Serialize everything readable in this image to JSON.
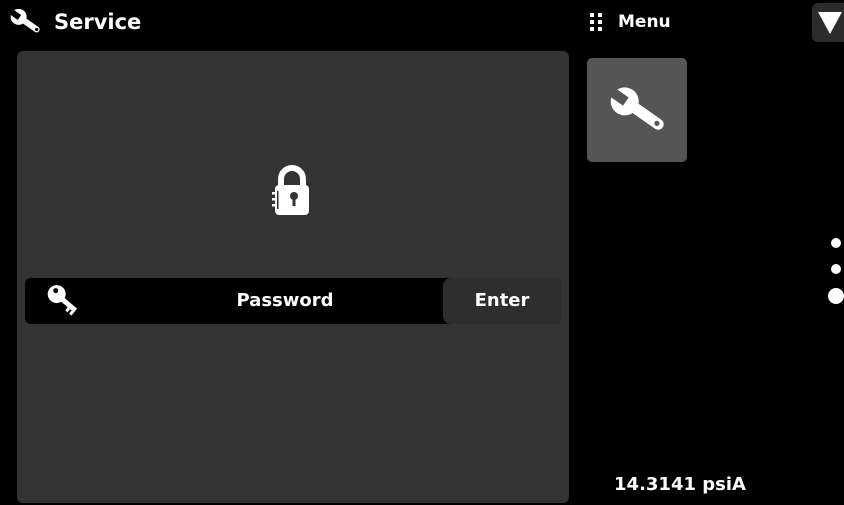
{
  "header": {
    "title": "Service",
    "title_icon": "wrench-icon",
    "menu_label": "Menu",
    "menu_icon": "grip-icon",
    "dropdown_icon": "triangle-down-icon"
  },
  "panel": {
    "lock_icon": "padlock-icon",
    "password": {
      "key_icon": "key-icon",
      "placeholder": "Password",
      "enter_label": "Enter"
    }
  },
  "sidebar": {
    "tile_icon": "wrench-icon"
  },
  "pager": {
    "page_count": 3,
    "active_page": 3
  },
  "status": {
    "reading": "14.3141 psiA"
  },
  "colors": {
    "background": "#000000",
    "panel": "#333333",
    "tile": "#555555",
    "text": "#ffffff"
  }
}
